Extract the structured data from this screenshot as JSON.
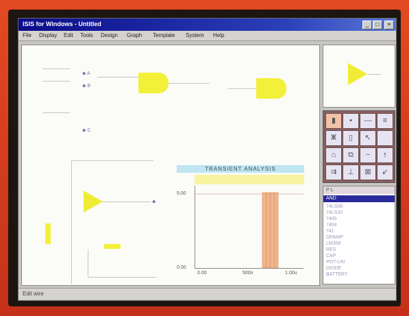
{
  "window": {
    "title": "ISIS for Windows - Untitled"
  },
  "titlebar_buttons": {
    "minimize": "_",
    "maximize": "□",
    "close": "×"
  },
  "menu": [
    "File",
    "Display",
    "Edit",
    "Tools",
    "Design",
    "Graph",
    "Template",
    "System",
    "Help"
  ],
  "schematic": {
    "pin_labels": [
      "A",
      "B",
      "C"
    ],
    "graph_title": "TRANSIENT ANALYSIS",
    "graph_y_ticks": [
      "5.00",
      "0.00"
    ],
    "graph_x_ticks": [
      "0.00",
      "500n",
      "1.00u"
    ]
  },
  "palette": {
    "icons": [
      "component-icon",
      "junction-icon",
      "wire-label-icon",
      "script-icon",
      "bus-icon",
      "subcircuit-icon",
      "pointer-icon",
      "blank-icon",
      "terminal-icon",
      "device-pin-icon",
      "generator-icon",
      "probe-icon",
      "tape-icon",
      "graph-icon",
      "rotate-icon",
      "mirror-icon"
    ],
    "glyphs": [
      "▮",
      "•",
      "—",
      "≡",
      "ⵥ",
      "▯",
      "↖",
      "",
      "⌂",
      "⧉",
      "~",
      "↑",
      "⇉",
      "⊥",
      "⊠",
      "↙"
    ]
  },
  "device_list": {
    "header": "P L",
    "selected": "AND",
    "items": [
      "74LS08",
      "74LS32",
      "7400",
      "7404",
      "741",
      "OPAMP",
      "LM358",
      "RES",
      "CAP",
      "POT-LIN",
      "DIODE",
      "BATTERY"
    ]
  },
  "statusbar": {
    "text": "Edit wire"
  }
}
